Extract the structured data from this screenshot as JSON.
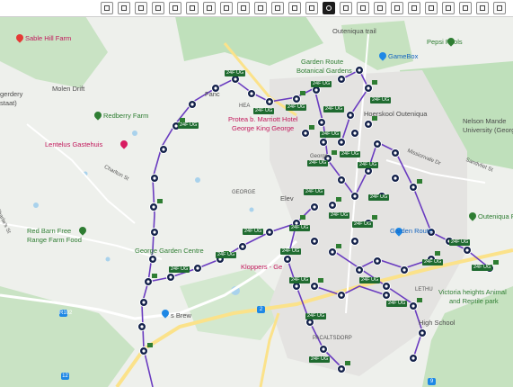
{
  "toolbar": {
    "buttons": [
      {
        "icon": "layers-icon"
      },
      {
        "icon": "grid-icon"
      },
      {
        "icon": "document-icon"
      },
      {
        "icon": "add-icon"
      },
      {
        "icon": "expand-icon"
      },
      {
        "icon": "tree-icon"
      },
      {
        "icon": "swap-icon"
      },
      {
        "icon": "link-icon"
      },
      {
        "icon": "rotate-left-icon"
      },
      {
        "icon": "crop-icon"
      },
      {
        "icon": "rotate-right-icon"
      },
      {
        "icon": "timer-icon"
      },
      {
        "icon": "refresh-icon"
      },
      {
        "icon": "route-icon",
        "active": true
      },
      {
        "icon": "stack-icon"
      },
      {
        "icon": "copy-icon"
      },
      {
        "icon": "photo-icon"
      },
      {
        "icon": "print-icon"
      },
      {
        "icon": "upload-icon"
      },
      {
        "icon": "compare-icon"
      },
      {
        "icon": "move-icon"
      },
      {
        "icon": "share-icon"
      },
      {
        "icon": "window-icon"
      },
      {
        "icon": "panel-icon"
      }
    ]
  },
  "map": {
    "colors": {
      "land": "#eef0ec",
      "green": "#bfe0bb",
      "water": "#a9d2ec",
      "road": "#ffffff",
      "highway": "#fbe28a",
      "route": "#6a3cc0",
      "stop": "#13214a"
    },
    "places": {
      "sable_hill_farm": "Sable Hill Farm",
      "molen_drift": "Molen Drift",
      "gerdery": "gerdery",
      "staat": "staat)",
      "redberry_farm": "Redberry Farm",
      "lentelus": "Lentelus Gastehuis",
      "red_barn_1": "Red Barn Free",
      "red_barn_2": "Range Farm Food",
      "charlies": "Charlie's St",
      "garden_centre": "George Garden Centre",
      "brew": "s Brew",
      "fancourt": "Fanc",
      "protea_1": "Protea b. Marriott Hotel",
      "protea_2": "George King George",
      "outeniqua_trail": "Outeniqua trail",
      "pepsi_pools": "Pepsi Pools",
      "botanical_1": "Garden Route",
      "botanical_2": "Botanical Gardens",
      "gamebox": "GameBox",
      "hoerskool": "Hoerskool Outeniqua",
      "nmu_1": "Nelson Mande",
      "nmu_2": "University (George",
      "garden_route_mall": "Garden Route",
      "outeniqua_fa": "Outeniqua Fa",
      "victoria_1": "Victoria heights Animal",
      "victoria_2": "and Reptile park",
      "high_school": "High School",
      "kloppers": "Kloppers - Ge",
      "george": "GEORGE",
      "george_city": "George",
      "eleven": "Elev",
      "heath": "HEA",
      "pacaltsdorp": "PACALTSDORP",
      "lethu": "LETHU",
      "charlton": "Charlton St",
      "sw_street": "Sandvliet St",
      "mission": "Missionvale Dr",
      "r102": "R102",
      "n2": "2",
      "n9": "9",
      "m12": "12"
    },
    "route_label": "24F",
    "route_label_2": "UG"
  }
}
